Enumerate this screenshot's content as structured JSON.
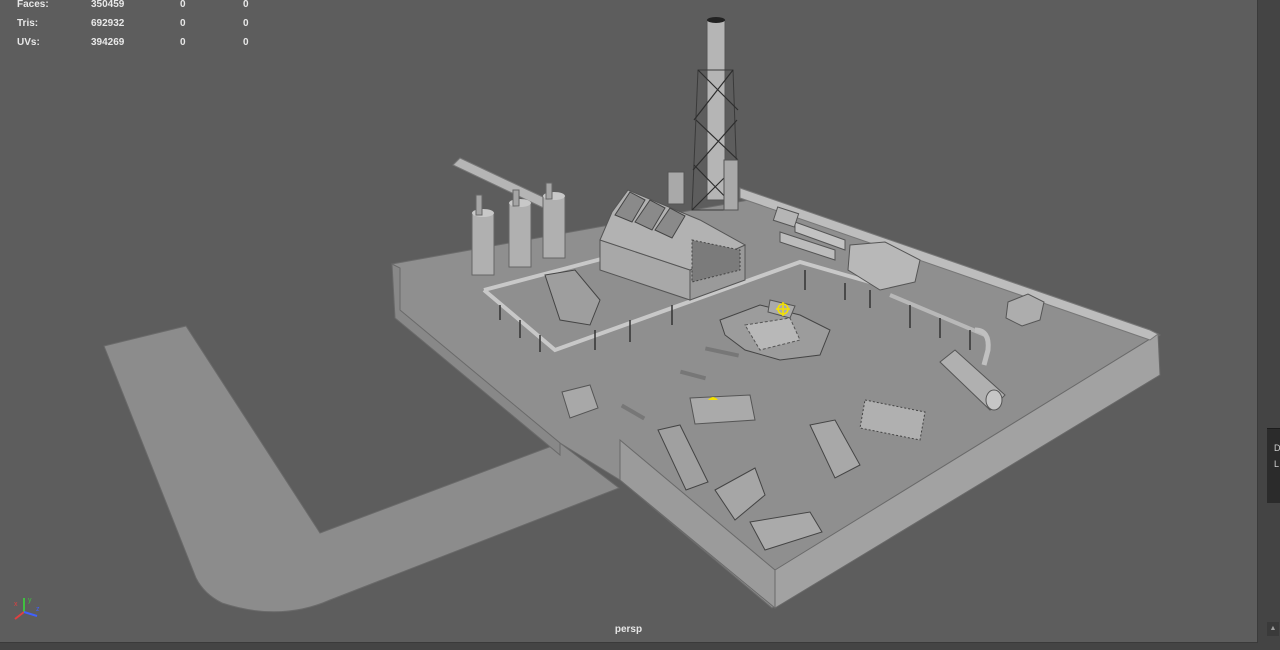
{
  "hud": {
    "rows": [
      {
        "label": "Faces:",
        "v1": "350459",
        "v2": "0",
        "v3": "0"
      },
      {
        "label": "Tris:",
        "v1": "692932",
        "v2": "0",
        "v3": "0"
      },
      {
        "label": "UVs:",
        "v1": "394269",
        "v2": "0",
        "v3": "0"
      }
    ]
  },
  "viewport": {
    "camera": "persp"
  },
  "right_panel": {
    "letter_1": "D",
    "letter_2": "L"
  },
  "colors": {
    "viewport_bg": "#5d5d5d",
    "ground": "#8f8f8f",
    "wall": "#999999",
    "model": "#a3a3a3",
    "manipulator": "#f5e200",
    "axis_x": "#e04040",
    "axis_y": "#40c040",
    "axis_z": "#4060ff"
  },
  "icons": {
    "axis_gizmo": "xyz-axis-icon",
    "pivot": "move-manipulator-icon"
  }
}
